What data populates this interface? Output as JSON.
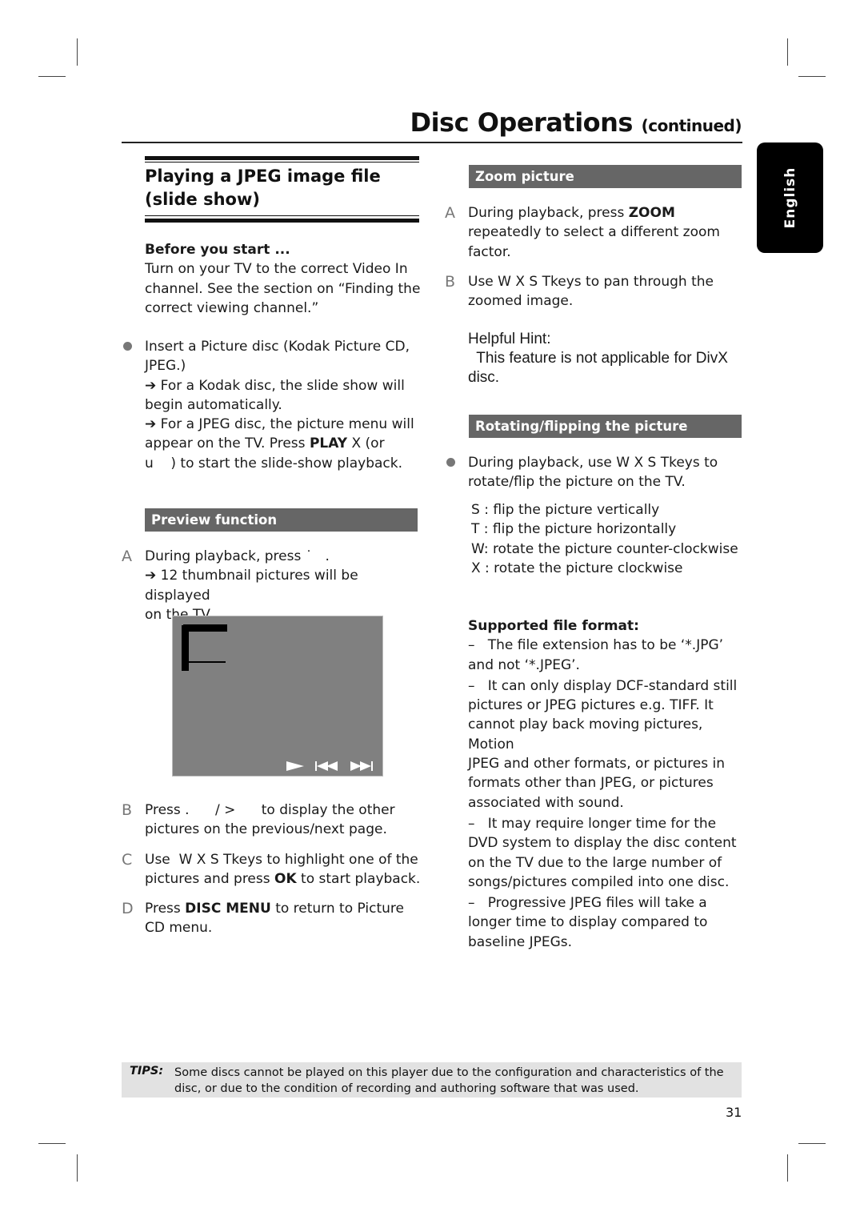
{
  "header": {
    "title": "Disc Operations",
    "title_suffix": "(continued)"
  },
  "language_tab": "English",
  "left": {
    "section_title_line1": "Playing a JPEG image file",
    "section_title_line2": "(slide show)",
    "before_start_heading": "Before you start ...",
    "before_start_text": [
      "Turn on your TV to the correct Video In",
      "channel.  See the section on “Finding the",
      "correct viewing channel.”"
    ],
    "bullet1": {
      "lines": [
        "Insert a Picture disc (Kodak Picture CD,",
        "JPEG.)"
      ],
      "result1": [
        "➔ For a Kodak disc, the slide show will",
        "begin automatically."
      ],
      "result2_line1": "➔ For a JPEG disc, the picture menu will",
      "result2_line2_pre": "appear on the TV.  Press ",
      "result2_line2_bold": "PLAY",
      "result2_line2_post": "  X (or",
      "result2_line3": "u    ) to start the slide-show playback."
    },
    "preview_bar": "Preview function",
    "preview_steps": {
      "a_marker": "A",
      "a_line1": "During playback, press ˙   .",
      "a_result": [
        "➔ 12 thumbnail pictures will be displayed",
        "on the TV."
      ],
      "b_marker": "B",
      "b_lines": [
        "Press .      / >      to display the other",
        "pictures on the previous/next page."
      ],
      "c_marker": "C",
      "c_line1": "Use  W X S Tkeys to highlight one of the",
      "c_line2_pre": "pictures and press ",
      "c_line2_bold": "OK",
      "c_line2_post": " to start playback.",
      "d_marker": "D",
      "d_line1_pre": "Press ",
      "d_line1_bold": "DISC MENU",
      "d_line1_post": " to return to Picture",
      "d_line2": "CD menu."
    },
    "screen_icons": [
      "play-icon",
      "previous-icon",
      "next-icon"
    ]
  },
  "right": {
    "zoom_bar": "Zoom picture",
    "zoom_a_marker": "A",
    "zoom_a_line1_pre": "During playback, press ",
    "zoom_a_line1_bold": "ZOOM",
    "zoom_a_lines": [
      "repeatedly to select a different zoom",
      "factor."
    ],
    "zoom_b_marker": "B",
    "zoom_b_lines": [
      "Use  W X S Tkeys to pan through the",
      "zoomed image."
    ],
    "hint_title": "Helpful Hint:",
    "hint_lines": [
      "  This feature is not applicable for DivX",
      "disc."
    ],
    "rotate_bar": "Rotating/flipping the picture",
    "rotate_lines": [
      "During playback, use  W X S Tkeys to",
      "rotate/flip the picture on the TV."
    ],
    "rotate_keys": [
      "S : flip the picture vertically",
      "T : flip the picture horizontally",
      "W: rotate the picture counter-clockwise",
      "X : rotate the picture clockwise"
    ],
    "format_heading": "Supported file format:",
    "format_lines": [
      "–   The file extension has to be ‘*.JPG’",
      "and not ‘*.JPEG’.",
      "–   It can only display DCF-standard still",
      "pictures or JPEG pictures e.g. TIFF.  It",
      "cannot play back moving pictures, Motion",
      "JPEG and other formats, or pictures in",
      "formats other than JPEG, or pictures",
      "associated with sound.",
      "–   It may require longer time for the",
      "DVD system to display the disc content",
      "on the TV due to the large number of",
      "songs/pictures compiled into one disc.",
      "–   Progressive JPEG files will take a",
      "longer time to display compared to",
      "baseline JPEGs."
    ]
  },
  "tips": {
    "label": "TIPS:",
    "lines": [
      "Some discs cannot be played on this player due to the configuration and characteristics of the",
      "disc, or due to the condition of recording and authoring software that was used."
    ]
  },
  "page_number": "31"
}
